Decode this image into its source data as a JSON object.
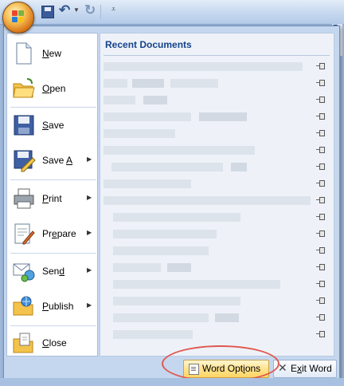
{
  "menu": {
    "commands": [
      {
        "id": "new",
        "label": "New",
        "accel": "N",
        "rest": "ew",
        "submenu": false,
        "icon": "new-document-icon"
      },
      {
        "id": "open",
        "label": "Open",
        "accel": "O",
        "rest": "pen",
        "submenu": false,
        "icon": "open-folder-icon"
      },
      {
        "id": "save",
        "label": "Save",
        "accel": "S",
        "rest": "ave",
        "submenu": false,
        "icon": "save-disk-icon"
      },
      {
        "id": "save-as",
        "label": "Save As",
        "pre": "Save ",
        "accel": "A",
        "rest": "s",
        "submenu": true,
        "icon": "save-as-icon"
      },
      {
        "id": "print",
        "label": "Print",
        "accel": "P",
        "rest": "rint",
        "submenu": true,
        "icon": "printer-icon"
      },
      {
        "id": "prepare",
        "label": "Prepare",
        "pre": "Pr",
        "accel": "e",
        "rest": "pare",
        "submenu": true,
        "icon": "prepare-icon"
      },
      {
        "id": "send",
        "label": "Send",
        "pre": "Sen",
        "accel": "d",
        "rest": "",
        "submenu": true,
        "icon": "send-icon"
      },
      {
        "id": "publish",
        "label": "Publish",
        "accel": "P",
        "rest": "ublish",
        "submenu": true,
        "icon": "publish-icon"
      },
      {
        "id": "close",
        "label": "Close",
        "accel": "C",
        "rest": "lose",
        "submenu": false,
        "icon": "close-folder-icon"
      }
    ],
    "recent_title": "Recent Documents",
    "recent_count": 17,
    "options_button": "Word Options",
    "options_accel": "i",
    "exit_button": "Exit Word",
    "exit_accel": "x"
  },
  "title_fragment": "R",
  "colors": {
    "accent": "#15428b",
    "highlight": "#e0574f",
    "button_gold": "#ffd564"
  }
}
